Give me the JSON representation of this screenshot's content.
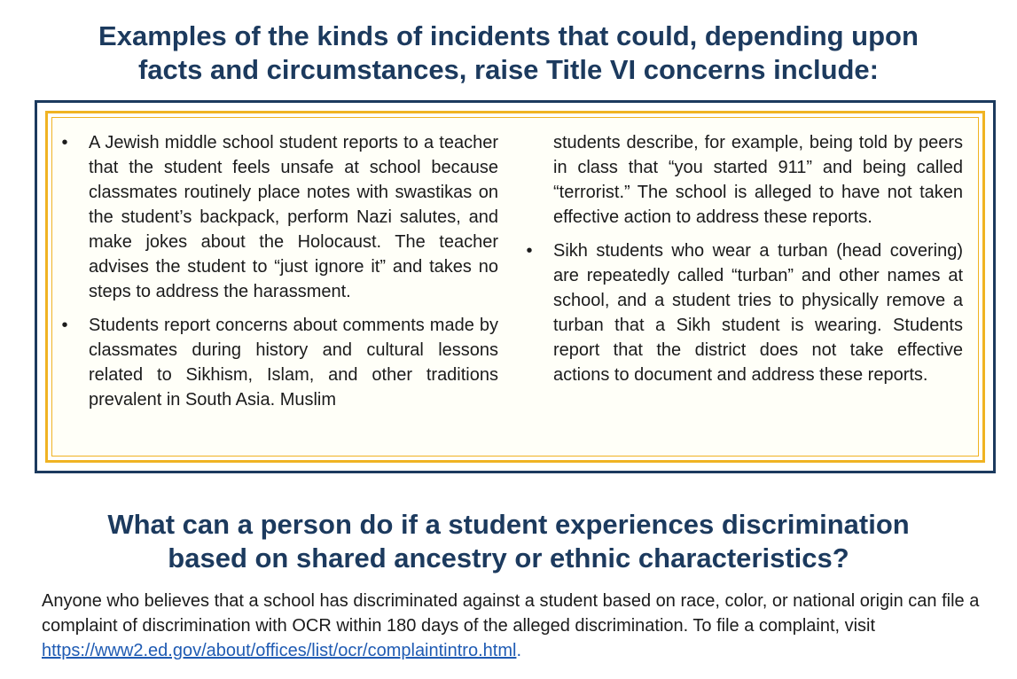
{
  "heading1": {
    "line1": "Examples of the kinds of incidents that could, depending upon",
    "line2": "facts and circumstances, raise Title VI concerns include:"
  },
  "examples": {
    "bullet_symbol": "•",
    "item1": "A Jewish middle school student reports to a teacher that the student feels unsafe at school because classmates routinely place notes with swastikas on the student’s backpack, perform Nazi salutes, and make jokes about the Holocaust. The teacher advises the student to “just ignore it” and takes no steps to address the harassment.",
    "item2_part1": "Students report concerns about comments made by classmates during history and cultural lessons related to Sikhism, Islam, and other traditions prevalent in South Asia. Muslim",
    "item2_part2": "students describe, for example, being told by peers in class that “you started 911” and being called “terrorist.” The school is alleged to have not taken effective action to address these reports.",
    "item3": "Sikh students who wear a turban (head covering) are repeatedly called “turban” and other names at school, and a student tries to physically remove a turban that a Sikh student is wearing. Students report that the district does not take effective actions to document and address these reports."
  },
  "heading2": {
    "line1": "What can a person do if a student experiences discrimination",
    "line2": "based on shared ancestry or ethnic characteristics?"
  },
  "complaint": {
    "text": "Anyone who believes that a school has discriminated against a student based on race, color, or national origin can file a complaint of discrimination with OCR within 180 days of the alleged discrimination. To file a complaint, visit ",
    "link_text": "https://www2.ed.gov/about/offices/list/ocr/complaintintro.html",
    "period": "."
  },
  "colors": {
    "heading": "#1c3a5e",
    "box_border": "#1c3a5e",
    "gold": "#f0b323",
    "link": "#1f5bb3"
  }
}
